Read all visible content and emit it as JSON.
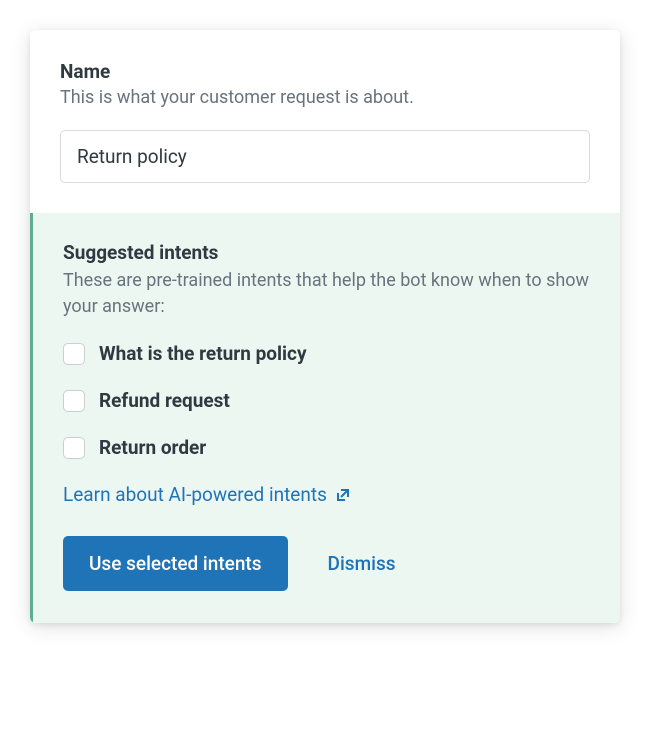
{
  "name_field": {
    "label": "Name",
    "description": "This is what your customer request is about.",
    "value": "Return policy"
  },
  "suggested": {
    "title": "Suggested intents",
    "description": "These are pre-trained intents that help the bot know when to show your answer:",
    "intents": [
      {
        "label": "What is the return policy",
        "checked": false
      },
      {
        "label": "Refund request",
        "checked": false
      },
      {
        "label": "Return order",
        "checked": false
      }
    ],
    "learn_link": "Learn about AI-powered intents",
    "use_button": "Use selected intents",
    "dismiss_button": "Dismiss"
  }
}
